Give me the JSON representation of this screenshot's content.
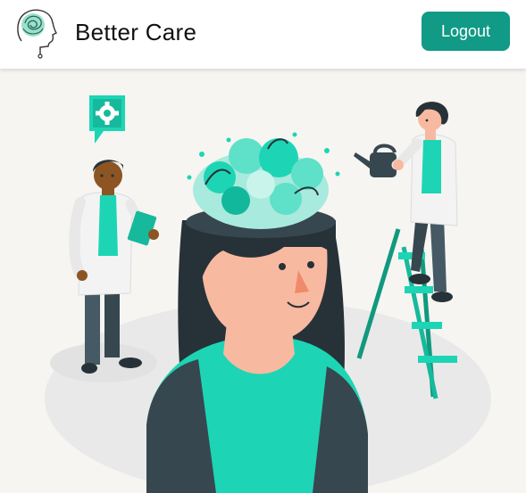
{
  "header": {
    "brand_name": "Better Care",
    "logout_label": "Logout"
  },
  "colors": {
    "accent": "#119a86",
    "teal": "#1dd5b4",
    "skin": "#f8b9a1",
    "dark": "#263238"
  },
  "icons": {
    "logo": "head-with-brain-scribble-icon",
    "gear": "gear-icon"
  }
}
